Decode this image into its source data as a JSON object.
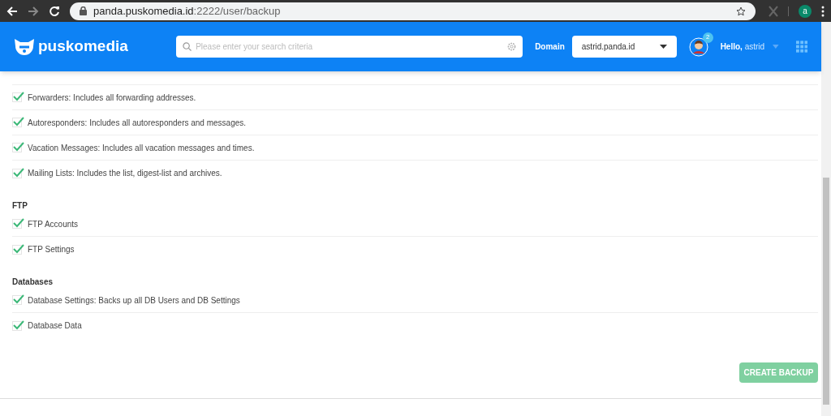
{
  "browser": {
    "url_host": "panda.puskomedia.id",
    "url_path": ":2222/user/backup",
    "profile": "a"
  },
  "header": {
    "logo": "puskomedia",
    "search_placeholder": "Please enter your search criteria",
    "domain_label": "Domain",
    "domain_value": "astrid.panda.id",
    "notification_count": "2",
    "greeting": "Hello,",
    "user": "astrid"
  },
  "sections": [
    {
      "items": [
        {
          "label": "Forwarders: Includes all forwarding addresses.",
          "checked": true
        },
        {
          "label": "Autoresponders: Includes all autoresponders and messages.",
          "checked": true
        },
        {
          "label": "Vacation Messages: Includes all vacation messages and times.",
          "checked": true
        },
        {
          "label": "Mailing Lists: Includes the list, digest-list and archives.",
          "checked": true
        }
      ]
    },
    {
      "title": "FTP",
      "items": [
        {
          "label": "FTP Accounts",
          "checked": true
        },
        {
          "label": "FTP Settings",
          "checked": true
        }
      ]
    },
    {
      "title": "Databases",
      "items": [
        {
          "label": "Database Settings: Backs up all DB Users and DB Settings",
          "checked": true
        },
        {
          "label": "Database Data",
          "checked": true
        }
      ]
    }
  ],
  "create_button": "CREATE BACKUP"
}
